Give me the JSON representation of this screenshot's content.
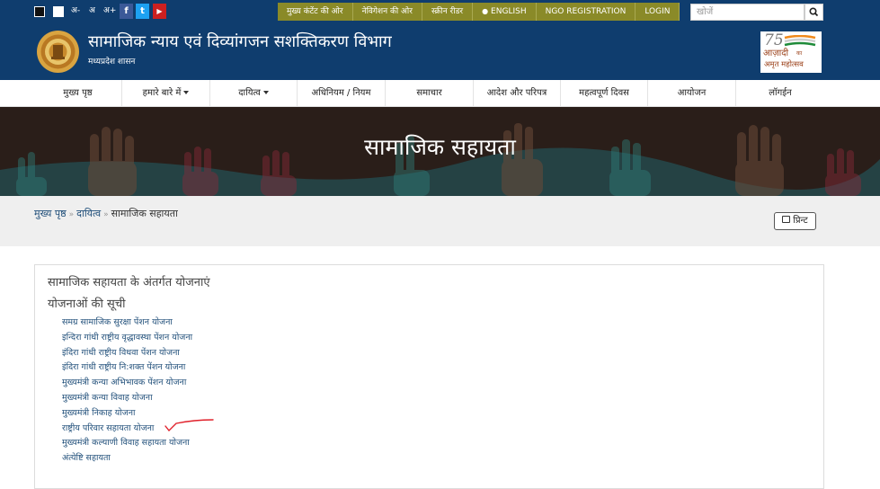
{
  "topbar": {
    "font_sizes": [
      "अ-",
      "अ",
      "अ+"
    ],
    "social": {
      "facebook": "f",
      "twitter": "t",
      "youtube": "▶"
    },
    "quick_links": [
      "मुख्य कंटेंट की ओर",
      "नेविगेशन की ओर",
      "स्क्रीन रीडर",
      "ENGLISH",
      "NGO REGISTRATION",
      "LOGIN"
    ],
    "search_placeholder": "खोजें"
  },
  "header": {
    "title": "सामाजिक न्याय एवं दिव्यांगजन सशक्तिकरण विभाग",
    "subtitle": "मध्यप्रदेश शासन",
    "badge_lines": [
      "आज़ादी",
      "का",
      "अमृत महोत्सव"
    ],
    "badge_number": "75"
  },
  "nav": {
    "items": [
      {
        "label": "मुख्य पृष्ठ",
        "dropdown": false
      },
      {
        "label": "हमारे बारे में",
        "dropdown": true
      },
      {
        "label": "दायित्व",
        "dropdown": true
      },
      {
        "label": "अधिनियम / नियम",
        "dropdown": false
      },
      {
        "label": "समाचार",
        "dropdown": false
      },
      {
        "label": "आदेश और परिपत्र",
        "dropdown": false
      },
      {
        "label": "महत्वपूर्ण दिवस",
        "dropdown": false
      },
      {
        "label": "आयोजन",
        "dropdown": false
      },
      {
        "label": "लॉगईन",
        "dropdown": false
      }
    ]
  },
  "banner": {
    "title": "सामाजिक सहायता"
  },
  "breadcrumb": {
    "home": "मुख्य पृष्ठ",
    "parent": "दायित्व",
    "current": "सामाजिक सहायता",
    "sep": "»"
  },
  "print_label": "प्रिन्ट",
  "content": {
    "heading": "सामाजिक सहायता के अंतर्गत योजनाएं",
    "list_title": "योजनाओं की सूची",
    "schemes": [
      "समग्र सामाजिक सुरक्षा पेंशन योजना",
      "इन्दिरा गांधी राष्ट्रीय वृद्धावस्था पेंशन योजना",
      "इंदिरा गांधी राष्ट्रीय विधवा पेंशन योजना",
      "इंदिरा गांधी राष्ट्रीय नि:शक्त पेंशन योजना",
      "मुख्यमंत्री कन्या अभिभावक पेंशन योजना",
      "मुख्यमंत्री कन्या विवाह योजना",
      "मुख्यमंत्री निकाह योजना",
      "राष्ट्रीय परिवार सहायता योजना",
      "मुख्यमंत्री कल्याणी विवाह सहायता योजना",
      "अंत्येष्टि सहायता"
    ]
  },
  "colors": {
    "header_bg": "#0f3d6e",
    "quick_link_bg": "#8a8a28",
    "link": "#1f4e79",
    "annotation_mark": "#e0202a"
  }
}
